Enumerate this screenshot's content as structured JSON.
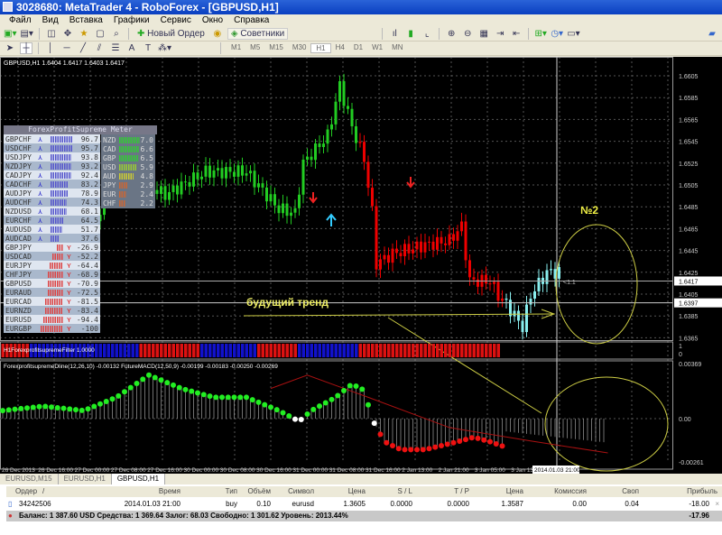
{
  "window": {
    "title": "3028680: MetaTrader 4 - RoboForex - [GBPUSD,H1]"
  },
  "menu": [
    "Файл",
    "Вид",
    "Вставка",
    "Графики",
    "Сервис",
    "Окно",
    "Справка"
  ],
  "toolbar": {
    "new_order": "Новый Ордер",
    "experts": "Советники",
    "text_tool": "A",
    "timeframes": [
      "M1",
      "M5",
      "M15",
      "M30",
      "H1",
      "H4",
      "D1",
      "W1",
      "MN"
    ],
    "active_timeframe": "H1"
  },
  "chart": {
    "header": "GBPUSD,H1  1.6404 1.6417 1.6403 1.6417",
    "price_ticks": [
      "1.6605",
      "1.6585",
      "1.6565",
      "1.6545",
      "1.6525",
      "1.6505",
      "1.6485",
      "1.6465",
      "1.6445",
      "1.6425",
      "1.6405",
      "1.6385",
      "1.6365"
    ],
    "bid_label": "1.6417",
    "ask_label": "1.6397",
    "annotation_trend": "будущий тренд",
    "annotation_no2": "№2",
    "level_label": "<1:1",
    "filter_label": "H1ForexprofitsupremeFilter 1.0000",
    "filter_axis": [
      "1",
      "0"
    ],
    "osc_label": "ForexprofitsupremeDline(12,26,10) -0.00132   FutureMACD(12,50,9) -0.00199 -0.00183 -0.00250 -0.00269",
    "osc_ticks": [
      "0.00369",
      "0.00",
      "-0.00261"
    ],
    "time_ticks": [
      "26 Dec 2013",
      "26 Dec 16:00",
      "27 Dec 00:00",
      "27 Dec 08:00",
      "27 Dec 16:00",
      "30 Dec 00:00",
      "30 Dec 08:00",
      "30 Dec 16:00",
      "31 Dec 00:00",
      "31 Dec 08:00",
      "31 Dec 16:00",
      "2 Jan 13:00",
      "2 Jan 21:00",
      "3 Jan 05:00",
      "3 Jan 13:00"
    ],
    "crosshair_time": "2014.01.03 21:00"
  },
  "meter": {
    "title": "ForexProfitSupreme Meter",
    "pairs": [
      {
        "sym": "GBPCHF",
        "val": "96.7",
        "up": true
      },
      {
        "sym": "USDCHF",
        "val": "95.7",
        "up": true
      },
      {
        "sym": "USDJPY",
        "val": "93.8",
        "up": true
      },
      {
        "sym": "NZDJPY",
        "val": "93.2",
        "up": true
      },
      {
        "sym": "CADJPY",
        "val": "92.4",
        "up": true
      },
      {
        "sym": "CADCHF",
        "val": "83.2",
        "up": true
      },
      {
        "sym": "AUDJPY",
        "val": "78.9",
        "up": true
      },
      {
        "sym": "AUDCHF",
        "val": "74.3",
        "up": true
      },
      {
        "sym": "NZDUSD",
        "val": "68.1",
        "up": true
      },
      {
        "sym": "EURCHF",
        "val": "64.5",
        "up": true
      },
      {
        "sym": "AUDUSD",
        "val": "51.7",
        "up": true
      },
      {
        "sym": "AUDCAD",
        "val": "37.6",
        "up": true
      },
      {
        "sym": "GBPJPY",
        "val": "-26.9",
        "up": false
      },
      {
        "sym": "USDCAD",
        "val": "-52.2",
        "up": false
      },
      {
        "sym": "EURJPY",
        "val": "-64.4",
        "up": false
      },
      {
        "sym": "CHFJPY",
        "val": "-68.9",
        "up": false
      },
      {
        "sym": "GBPUSD",
        "val": "-70.9",
        "up": false
      },
      {
        "sym": "EURAUD",
        "val": "-72.5",
        "up": false
      },
      {
        "sym": "EURCAD",
        "val": "-81.5",
        "up": false
      },
      {
        "sym": "EURNZD",
        "val": "-83.4",
        "up": false
      },
      {
        "sym": "EURUSD",
        "val": "-94.4",
        "up": false
      },
      {
        "sym": "EURGBP",
        "val": "-100",
        "up": false
      }
    ],
    "currencies": [
      {
        "cur": "NZD",
        "val": "7.0",
        "color": "#3c3"
      },
      {
        "cur": "CAD",
        "val": "6.6",
        "color": "#3c3"
      },
      {
        "cur": "GBP",
        "val": "6.5",
        "color": "#3c3"
      },
      {
        "cur": "USD",
        "val": "5.9",
        "color": "#9c3"
      },
      {
        "cur": "AUD",
        "val": "4.8",
        "color": "#cc3"
      },
      {
        "cur": "JPY",
        "val": "2.9",
        "color": "#c63"
      },
      {
        "cur": "EUR",
        "val": "2.4",
        "color": "#c63"
      },
      {
        "cur": "CHF",
        "val": "2.2",
        "color": "#c63"
      }
    ]
  },
  "chart_data": {
    "type": "candlestick",
    "symbol": "GBPUSD",
    "timeframe": "H1",
    "ylim": [
      1.6355,
      1.6615
    ],
    "price_path": [
      [
        0,
        1.6379
      ],
      [
        20,
        1.6425
      ],
      [
        28,
        1.6542
      ],
      [
        34,
        1.6508
      ],
      [
        40,
        1.6496
      ],
      [
        50,
        1.6517
      ],
      [
        60,
        1.6517
      ],
      [
        68,
        1.6483
      ],
      [
        72,
        1.6479
      ],
      [
        74,
        1.6525
      ],
      [
        80,
        1.655
      ],
      [
        83,
        1.6596
      ],
      [
        86,
        1.6558
      ],
      [
        89,
        1.6529
      ],
      [
        91,
        1.648
      ],
      [
        92,
        1.6433
      ],
      [
        96,
        1.6442
      ],
      [
        104,
        1.645
      ],
      [
        110,
        1.6454
      ],
      [
        113,
        1.6467
      ],
      [
        115,
        1.6417
      ],
      [
        120,
        1.6417
      ],
      [
        122,
        1.6404
      ],
      [
        124,
        1.6396
      ],
      [
        128,
        1.6375
      ],
      [
        130,
        1.6404
      ],
      [
        134,
        1.6425
      ],
      [
        137,
        1.6425
      ]
    ],
    "future_from_index": 124,
    "filter_segments": [
      [
        "red",
        0,
        7
      ],
      [
        "blue",
        7,
        34
      ],
      [
        "red",
        34,
        49
      ],
      [
        "blue",
        49,
        63
      ],
      [
        "red",
        63,
        73
      ],
      [
        "blue",
        73,
        88
      ],
      [
        "red",
        88,
        123
      ]
    ],
    "osc_dots": [
      [
        0,
        0.00054
      ],
      [
        10,
        0.00083
      ],
      [
        20,
        0.00054
      ],
      [
        28,
        0.00143
      ],
      [
        36,
        0.00292
      ],
      [
        44,
        0.00202
      ],
      [
        52,
        0.00143
      ],
      [
        60,
        0.00143
      ],
      [
        68,
        0.00054
      ],
      [
        73,
        -0.00018
      ],
      [
        76,
        0.00054
      ],
      [
        82,
        0.00143
      ],
      [
        86,
        0.00232
      ],
      [
        89,
        0.0019
      ],
      [
        91,
        -6e-05
      ],
      [
        94,
        -0.00155
      ],
      [
        98,
        -0.00208
      ],
      [
        104,
        -0.00208
      ],
      [
        112,
        -0.00155
      ],
      [
        116,
        -0.00125
      ],
      [
        120,
        -0.00155
      ],
      [
        123,
        -0.00184
      ]
    ],
    "osc_line": [
      [
        66,
        0.00202
      ],
      [
        75,
        0.00292
      ],
      [
        90,
        0.00143
      ],
      [
        110,
        -0.0006
      ],
      [
        130,
        -0.0015
      ],
      [
        149,
        -0.0023
      ]
    ],
    "osc_ylim": [
      -0.00261,
      0.00369
    ]
  },
  "tabs": [
    "EURUSD,M15",
    "EURUSD,H1",
    "GBPUSD,H1"
  ],
  "active_tab": "GBPUSD,H1",
  "terminal": {
    "headers": [
      "Ордер",
      "/",
      "Время",
      "Тип",
      "Объём",
      "Символ",
      "Цена",
      "S / L",
      "T / P",
      "Цена",
      "Комиссия",
      "Своп",
      "Прибыль"
    ],
    "row": {
      "order": "34242506",
      "time": "2014.01.03 21:00",
      "type": "buy",
      "volume": "0.10",
      "symbol": "eurusd",
      "open_price": "1.3605",
      "sl": "0.0000",
      "tp": "0.0000",
      "price": "1.3587",
      "commission": "0.00",
      "swap": "0.04",
      "profit": "-18.00"
    },
    "balance": "Баланс: 1 387.60 USD  Средства: 1 369.64  Залог: 68.03  Свободно: 1 301.62  Уровень: 2013.44%",
    "total": "-17.96"
  }
}
